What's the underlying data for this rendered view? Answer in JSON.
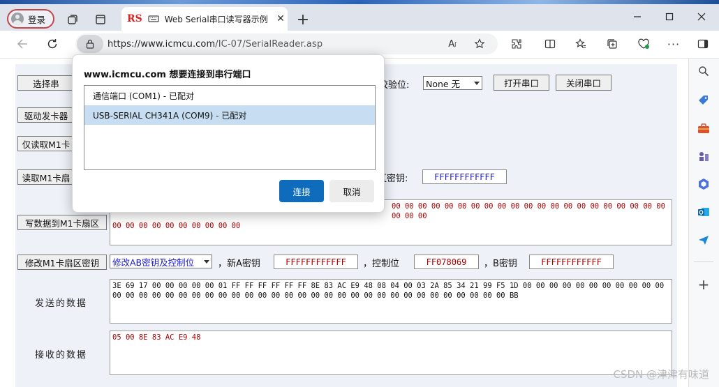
{
  "browser": {
    "profile_label": "登录",
    "tab_badge": "RS",
    "tab_title": "Web Serial串口读写器示例",
    "url_host": "https://www.icmcu.com",
    "url_path": "/IC-07/SerialReader.asp",
    "window_controls": [
      "minimize-icon",
      "maximize-icon",
      "close-icon"
    ]
  },
  "page": {
    "select_port_button": "选择串",
    "parity_label": "校验位:",
    "parity_value": "None 无",
    "open_port_button": "打开串口",
    "close_port_button": "关闭串口",
    "driver_button": "驱动发卡器",
    "read_uid_button": "仅读取M1卡",
    "read_sector_button": "读取M1卡扇",
    "sector_key_label": "区密钥:",
    "sector_key_value": "FFFFFFFFFFFF",
    "write_sector_button": "写数据到M1卡扇区",
    "write_data_line1": "00 00 00 00 00 00 00 00 00 00 00 00 00 00 00 00 00 00 00 00 00 00 00 00",
    "write_data_line2": "00 00 00 00 00 00 00 00 00 00",
    "modify_key_button": "修改M1卡扇区密钥",
    "modify_option": "修改AB密钥及控制位",
    "new_a_key_label": "，新A密钥",
    "new_a_key_value": "FFFFFFFFFFFF",
    "control_label": "，控制位",
    "control_value": "FF078069",
    "b_key_label": "，B密钥",
    "b_key_value": "FFFFFFFFFFFF",
    "sent_label": "发送的数据",
    "sent_data": "3E 69 17 00 00 00 00 00 01 FF FF FF FF FF FF 8E 83 AC E9 48 08 04 00 03 2A 85 34 21 99 F5 1D 00 00 00 00 00 00 00 00 00 00 00 00 00 00 00 00 00 00 00 00 00 00 00 00 00 00 00 00 00 00 00 00 00 00 00 00 00 00 00 00 00 BB",
    "received_label": "接收的数据",
    "received_data": "05 00 8E 83 AC E9 48"
  },
  "dialog": {
    "title": "www.icmcu.com 想要连接到串行端口",
    "ports": [
      {
        "label": "通信端口 (COM1) - 已配对",
        "selected": false
      },
      {
        "label": "USB-SERIAL CH341A (COM9) - 已配对",
        "selected": true
      }
    ],
    "connect_button": "连接",
    "cancel_button": "取消"
  },
  "sidebar_icons": [
    "search-icon",
    "tag-icon",
    "toolbox-icon",
    "chess-icon",
    "copilot-icon",
    "outlook-icon",
    "send-icon",
    "add-icon"
  ],
  "watermark": "CSDN @津津有味道",
  "colors": {
    "accent": "#0f6cbd",
    "selected_row": "#c7def2",
    "hex_red": "#a00000",
    "key_blue": "#1a1acc",
    "profile_border": "#c5474b"
  }
}
